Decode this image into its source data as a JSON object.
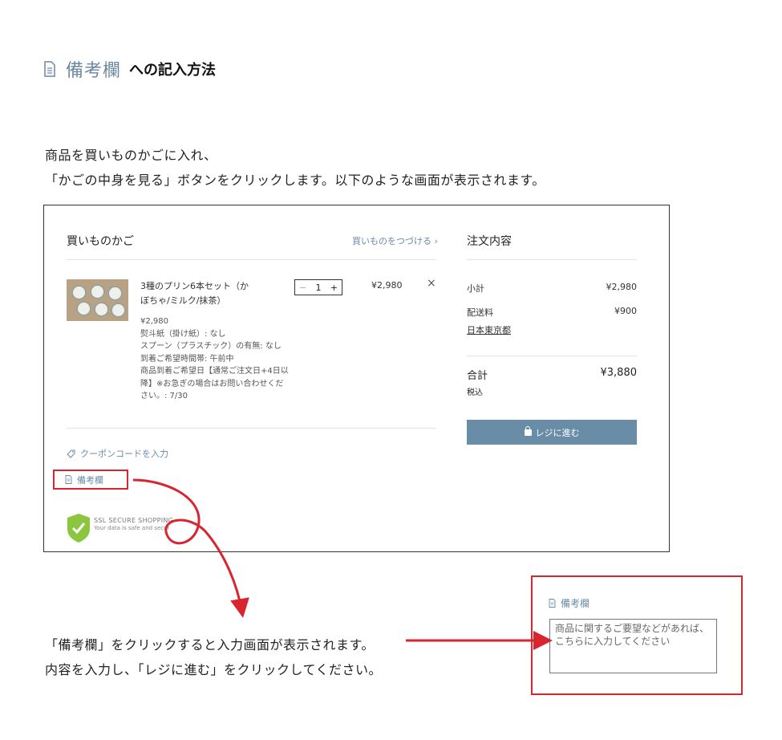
{
  "heading": {
    "accent": "備考欄",
    "rest": "への記入方法"
  },
  "intro": {
    "line1": "商品を買いものかごに入れ、",
    "line2": "「かごの中身を見る」ボタンをクリックします。以下のような画面が表示されます。"
  },
  "cart": {
    "title": "買いものかご",
    "continue_link": "買いものをつづける ›",
    "item": {
      "name_line1": "3種のプリン6本セット（か",
      "name_line2": "ぼちゃ/ミルク/抹茶）",
      "quantity": "1",
      "price": "¥2,980",
      "remove": "×",
      "details": [
        "¥2,980",
        "熨斗紙（掛け紙）: なし",
        "スプーン（プラスチック）の有無: なし",
        "到着ご希望時間帯: 午前中",
        "商品到着ご希望日【通常ご注文日+4日以",
        "降】※お急ぎの場合はお問い合わせくだ",
        "さい。: 7/30"
      ]
    },
    "coupon": "クーポンコードを入力",
    "memo": "備考欄",
    "ssl": {
      "title": "SSL  SECURE SHOPPING",
      "sub": "Your data is safe and secur"
    }
  },
  "summary": {
    "title": "注文内容",
    "subtotal_label": "小計",
    "subtotal": "¥2,980",
    "shipping_label": "配送料",
    "shipping": "¥900",
    "region": "日本東京都",
    "total_label": "合計",
    "total": "¥3,880",
    "tax_note": "税込",
    "checkout": "レジに進む"
  },
  "callout": {
    "line1": "「備考欄」をクリックすると入力画面が表示されます。",
    "line2": "内容を入力し、「レジに進む」をクリックしてください。"
  },
  "zoom": {
    "label": "備考欄",
    "placeholder": "商品に関するご要望などがあれば、こちらに入力してください"
  },
  "colors": {
    "accent": "#6a8aa6",
    "button": "#6a8da7",
    "annotation": "#d8252f"
  },
  "icons": [
    "document-icon",
    "tag-icon",
    "lock-icon",
    "close-icon",
    "shield-check-icon",
    "arrow-icon"
  ]
}
